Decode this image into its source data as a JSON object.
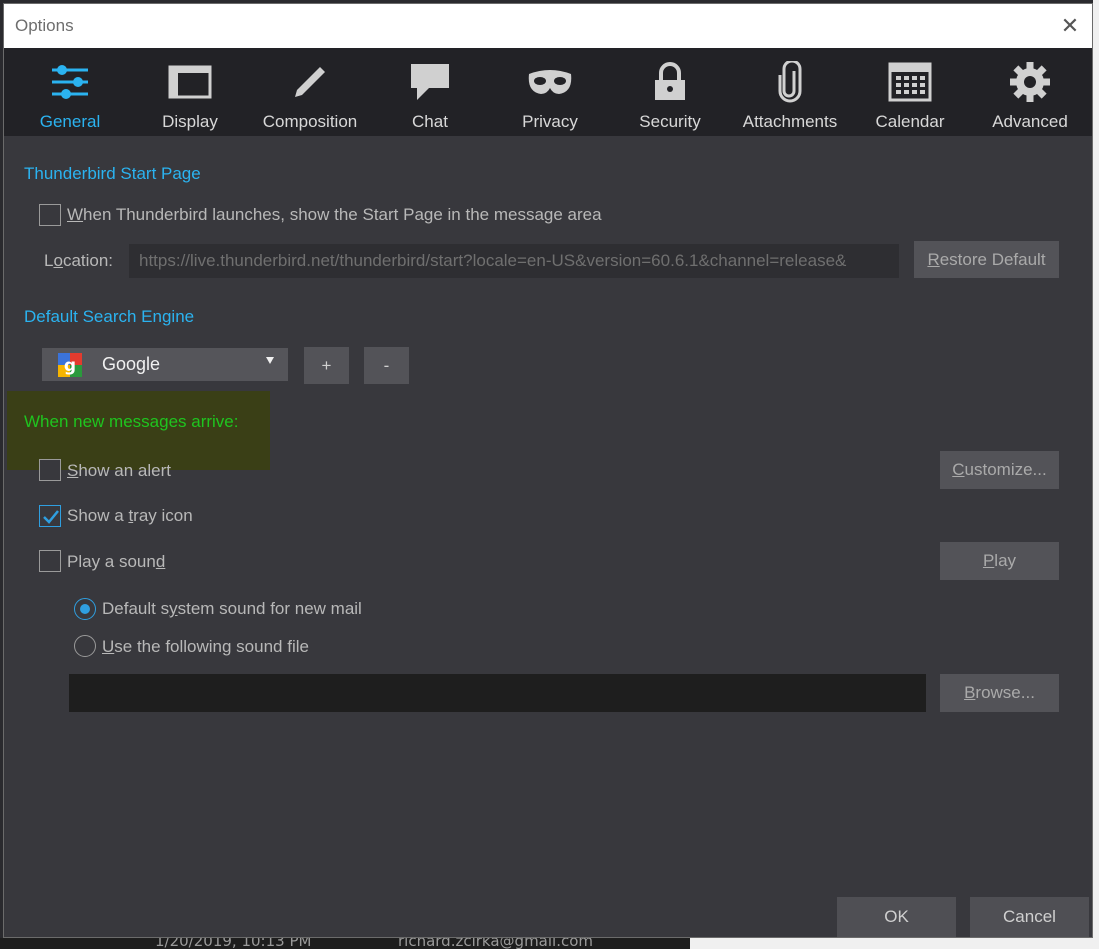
{
  "window": {
    "title": "Options",
    "close_glyph": "✕"
  },
  "tabs": [
    {
      "label": "General",
      "icon": "sliders-icon",
      "selected": true
    },
    {
      "label": "Display",
      "icon": "window-icon"
    },
    {
      "label": "Composition",
      "icon": "pencil-icon"
    },
    {
      "label": "Chat",
      "icon": "speech-bubble-icon"
    },
    {
      "label": "Privacy",
      "icon": "mask-icon"
    },
    {
      "label": "Security",
      "icon": "padlock-icon"
    },
    {
      "label": "Attachments",
      "icon": "paperclip-icon"
    },
    {
      "label": "Calendar",
      "icon": "calendar-grid-icon"
    },
    {
      "label": "Advanced",
      "icon": "gear-icon"
    }
  ],
  "start_page": {
    "heading": "Thunderbird Start Page",
    "show_start_page_label_pre": "",
    "show_start_page_label_u": "W",
    "show_start_page_label_post": "hen Thunderbird launches, show the Start Page in the message area",
    "show_start_page_checked": false,
    "location_label_pre": "L",
    "location_label_u": "o",
    "location_label_post": "cation:",
    "location_value": "https://live.thunderbird.net/thunderbird/start?locale=en-US&version=60.6.1&channel=release&",
    "restore_u": "R",
    "restore_post": "estore Default"
  },
  "search": {
    "heading": "Default Search Engine",
    "engine": "Google",
    "add_label": "+",
    "remove_label": "-"
  },
  "new_messages": {
    "heading": "When new messages arrive:",
    "alert_u": "S",
    "alert_post": "how an alert",
    "alert_checked": false,
    "customize_u": "C",
    "customize_post": "ustomize...",
    "tray_pre": "Show a ",
    "tray_u": "t",
    "tray_post": "ray icon",
    "tray_checked": true,
    "sound_pre": "Play a soun",
    "sound_u": "d",
    "sound_checked": false,
    "play_u": "P",
    "play_post": "lay",
    "default_sound_pre": "Default s",
    "default_sound_u": "y",
    "default_sound_post": "stem sound for new mail",
    "custom_sound_u": "U",
    "custom_sound_post": "se the following sound file",
    "sound_file_value": "",
    "browse_u": "B",
    "browse_post": "rowse..."
  },
  "footer": {
    "ok_label": "OK",
    "cancel_label": "Cancel"
  },
  "background": {
    "date_fragment": "1/20/2019, 10:13 PM",
    "email_fragment": "richard.zcirka@gmail.com"
  },
  "colors": {
    "accent": "#2bb3f0",
    "highlight_text": "#1fc41f",
    "dialog_bg": "#38383d",
    "toolbar_bg": "#222226"
  }
}
